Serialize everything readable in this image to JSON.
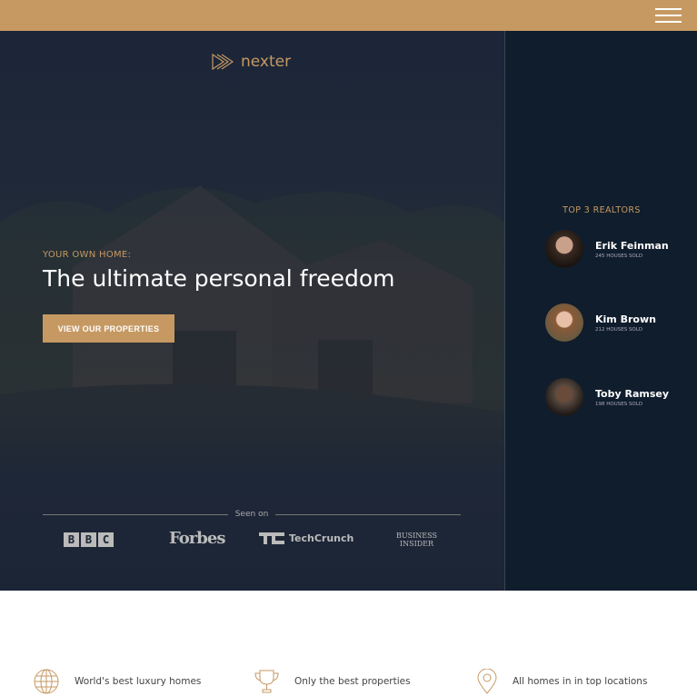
{
  "header": {
    "menu_icon": "hamburger-icon"
  },
  "brand": {
    "name": "nexter",
    "logo_icon": "triple-play-logo-icon"
  },
  "hero": {
    "kicker": "YOUR OWN HOME:",
    "title": "The ultimate personal freedom",
    "cta": "VIEW OUR PROPERTIES",
    "seen_on": "Seen on",
    "press": [
      {
        "name": "BBC",
        "letters": [
          "B",
          "B",
          "C"
        ]
      },
      {
        "name": "Forbes"
      },
      {
        "name": "TechCrunch"
      },
      {
        "name": "Business Insider",
        "line1": "BUSINESS",
        "line2": "INSIDER"
      }
    ]
  },
  "realtors": {
    "title": "TOP 3 REALTORS",
    "items": [
      {
        "name": "Erik Feinman",
        "sold": "245 HOUSES SOLD"
      },
      {
        "name": "Kim Brown",
        "sold": "212 HOUSES SOLD"
      },
      {
        "name": "Toby Ramsey",
        "sold": "198 HOUSES SOLD"
      }
    ]
  },
  "features": [
    {
      "icon": "globe-icon",
      "text": "World's best luxury homes"
    },
    {
      "icon": "trophy-icon",
      "text": "Only the best properties"
    },
    {
      "icon": "map-pin-icon",
      "text": "All homes in in top locations"
    }
  ],
  "colors": {
    "accent": "#c69963",
    "sidebar": "#101d2c",
    "hero": "#1c2537"
  }
}
